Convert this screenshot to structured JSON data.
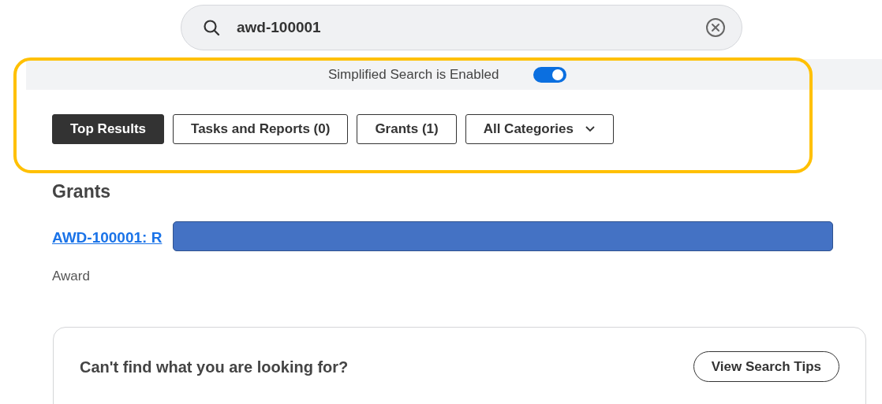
{
  "search": {
    "value": "awd-100001"
  },
  "simplified_search": {
    "label": "Simplified Search is Enabled",
    "on": true
  },
  "filters": [
    {
      "label": "Top Results",
      "selected": true,
      "kind": "tab"
    },
    {
      "label": "Tasks and Reports (0)",
      "selected": false,
      "kind": "tab"
    },
    {
      "label": "Grants (1)",
      "selected": false,
      "kind": "tab"
    },
    {
      "label": "All Categories",
      "selected": false,
      "kind": "dropdown"
    }
  ],
  "results": {
    "heading": "Grants",
    "items": [
      {
        "title": "AWD-100001: R",
        "type": "Award"
      }
    ]
  },
  "help_card": {
    "text": "Can't find what you are looking for?",
    "button": "View Search Tips"
  }
}
